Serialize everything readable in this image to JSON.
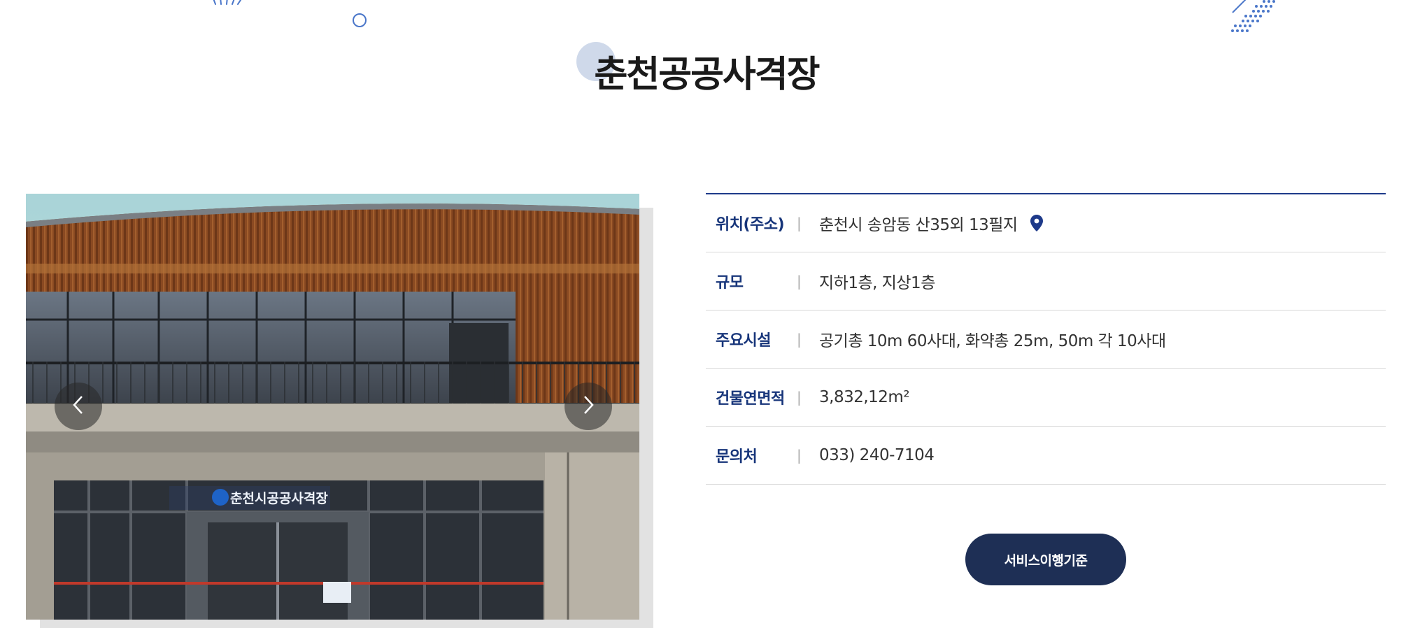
{
  "page": {
    "title": "춘천공공사격장"
  },
  "slider": {
    "image": "building-photo",
    "prev_icon": "chevron-left-icon",
    "next_icon": "chevron-right-icon",
    "signage_text": "춘천시공공사격장"
  },
  "info": {
    "rows": [
      {
        "label": "위치(주소)",
        "separator": "|",
        "value": "춘천시 송암동 산35외 13필지"
      },
      {
        "label": "규모",
        "separator": "|",
        "value": "지하1층, 지상1층"
      },
      {
        "label": "주요시설",
        "separator": "|",
        "value": "공기총 10m 60사대, 화약총 25m, 50m 각 10사대"
      },
      {
        "label": "건물연면적",
        "separator": "|",
        "value": "3,832,12m²"
      },
      {
        "label": "문의처",
        "separator": "|",
        "value": "033) 240-7104"
      }
    ],
    "location_icon": "map-pin-icon"
  },
  "buttons": {
    "service_standard": "서비스이행기준"
  },
  "colors": {
    "accent_navy": "#1e3a8a",
    "label_navy": "#17357a",
    "button_bg": "#1e2f55",
    "title_bubble": "#cfd9ea"
  }
}
